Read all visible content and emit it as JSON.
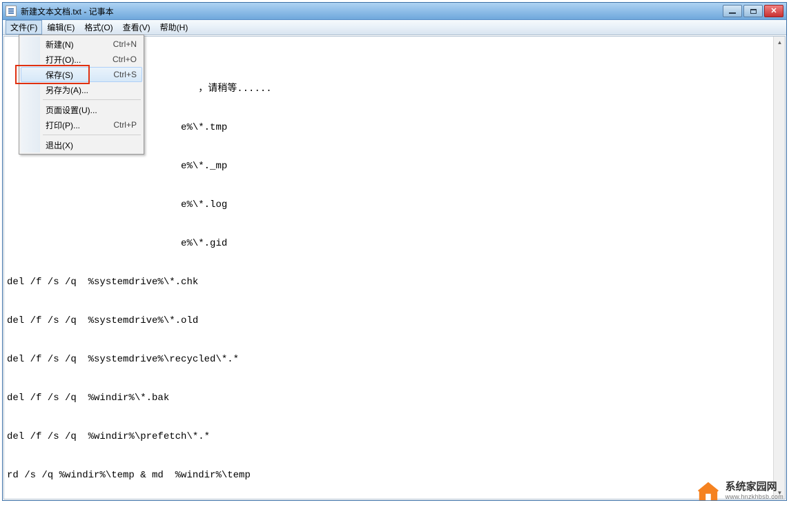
{
  "window": {
    "title": "新建文本文档.txt - 记事本"
  },
  "menubar": {
    "file": "文件(F)",
    "edit": "编辑(E)",
    "format": "格式(O)",
    "view": "查看(V)",
    "help": "帮助(H)"
  },
  "file_menu": {
    "new": {
      "label": "新建(N)",
      "shortcut": "Ctrl+N"
    },
    "open": {
      "label": "打开(O)...",
      "shortcut": "Ctrl+O"
    },
    "save": {
      "label": "保存(S)",
      "shortcut": "Ctrl+S"
    },
    "saveas": {
      "label": "另存为(A)...",
      "shortcut": ""
    },
    "pagesetup": {
      "label": "页面设置(U)...",
      "shortcut": ""
    },
    "print": {
      "label": "打印(P)...",
      "shortcut": "Ctrl+P"
    },
    "exit": {
      "label": "退出(X)",
      "shortcut": ""
    }
  },
  "editor": {
    "content": "\n\n                                 ，请稍等......\n\n                              e%\\*.tmp\n\n                              e%\\*._mp\n\n                              e%\\*.log\n\n                              e%\\*.gid\n\ndel /f /s /q  %systemdrive%\\*.chk\n\ndel /f /s /q  %systemdrive%\\*.old\n\ndel /f /s /q  %systemdrive%\\recycled\\*.*\n\ndel /f /s /q  %windir%\\*.bak\n\ndel /f /s /q  %windir%\\prefetch\\*.*\n\nrd /s /q %windir%\\temp & md  %windir%\\temp\n\ndel /f /q  %userprofile%\\cookies\\*.*\n\ndel /f /q  %userprofile%\\recent\\*.*\n\ndel /f /s /q  \"%userprofile%\\Local Settings\\Temporary Internet Files\\*.*\"\n\ndel /f /s /q  \"%userprofile%\\Local Settings\\Temp\\*.*\"\n\ndel /f /s /q  \"%userprofile%\\recent\\*.*\"\n\necho 清除系统LJ完成！\n\necho. & pause"
  },
  "watermark": {
    "title": "系统家园网",
    "url": "www.hnzkhbsb.com"
  }
}
